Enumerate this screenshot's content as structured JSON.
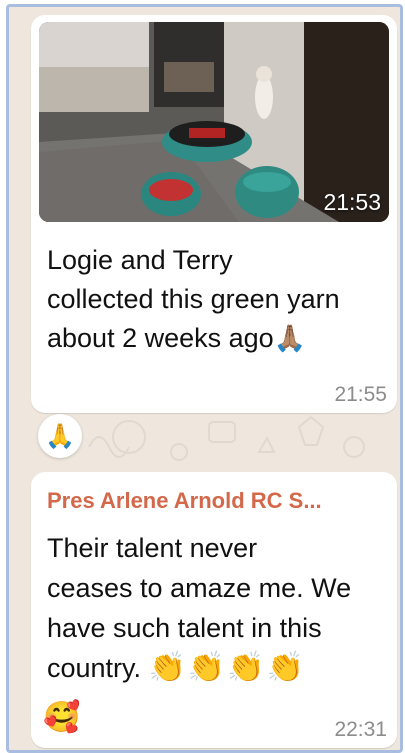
{
  "messages": [
    {
      "type": "image",
      "image_time": "21:53",
      "caption_lines": [
        "Logie and Terry",
        "collected this green yarn",
        "about 2 weeks ago"
      ],
      "caption_emoji": "🙏🏽",
      "time": "21:55",
      "reaction_emoji": "🙏"
    },
    {
      "type": "text",
      "sender": "Pres Arlene Arnold RC S...",
      "text_lines": [
        "Their talent never",
        "ceases to amaze me. We",
        "have such talent in this",
        "country."
      ],
      "clap_emojis": "👏👏👏👏",
      "smiley_emoji": "🥰",
      "time": "22:31"
    }
  ],
  "colors": {
    "chat_background": "#efe7dd",
    "bubble": "#ffffff",
    "sender_name": "#d3684a",
    "timestamp": "#8c8c8c",
    "frame_border": "#a9bde0"
  },
  "icons": {
    "reaction": "folded-hands-icon"
  }
}
